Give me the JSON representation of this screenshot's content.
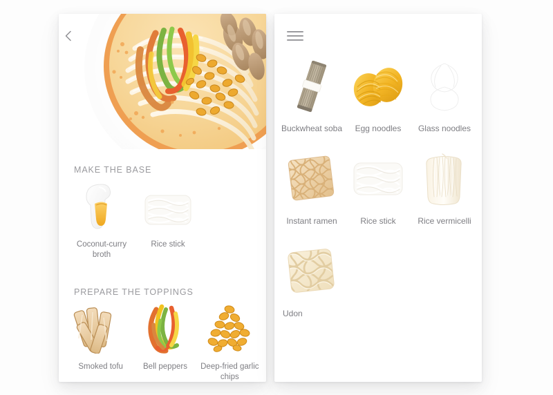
{
  "page": {
    "background_color": "#fdfdfd"
  },
  "colors": {
    "card_background": "#ffffff",
    "section_title": "#9a9a9e",
    "caption": "#7d7d82",
    "icon_gray": "#9b9b9f",
    "broth_orange": "#f2b842",
    "egg_noodle_yellow": "#f0b92c",
    "soba_tan": "#b3a893",
    "ramen_tan": "#e8cfa6",
    "udon_cream": "#f1e3c6"
  },
  "left_panel": {
    "back_button": {
      "icon": "chevron-left-icon",
      "label": "Back"
    },
    "hero_image": {
      "alt": "Bowl of coconut curry noodle soup with peppers, mushrooms and fried garlic chips"
    },
    "sections": [
      {
        "id": "make-the-base",
        "title": "MAKE THE BASE",
        "items": [
          {
            "label": "Coconut-curry broth",
            "icon": "spoon-broth-icon"
          },
          {
            "label": "Rice stick",
            "icon": "rice-stick-icon"
          }
        ]
      },
      {
        "id": "prepare-the-toppings",
        "title": "PREPARE THE TOPPINGS",
        "items": [
          {
            "label": "Smoked tofu",
            "icon": "smoked-tofu-icon"
          },
          {
            "label": "Bell peppers",
            "icon": "bell-peppers-icon"
          },
          {
            "label": "Deep-fried garlic chips",
            "icon": "garlic-chips-icon"
          }
        ]
      }
    ]
  },
  "right_panel": {
    "menu_button": {
      "icon": "hamburger-menu-icon",
      "label": "Menu"
    },
    "noodles": [
      {
        "label": "Buckwheat soba",
        "icon": "buckwheat-soba-icon"
      },
      {
        "label": "Egg noodles",
        "icon": "egg-noodles-icon"
      },
      {
        "label": "Glass noodles",
        "icon": "glass-noodles-icon"
      },
      {
        "label": "Instant ramen",
        "icon": "instant-ramen-icon"
      },
      {
        "label": "Rice stick",
        "icon": "rice-stick-icon"
      },
      {
        "label": "Rice vermicelli",
        "icon": "rice-vermicelli-icon"
      },
      {
        "label": "Udon",
        "icon": "udon-icon"
      }
    ]
  }
}
